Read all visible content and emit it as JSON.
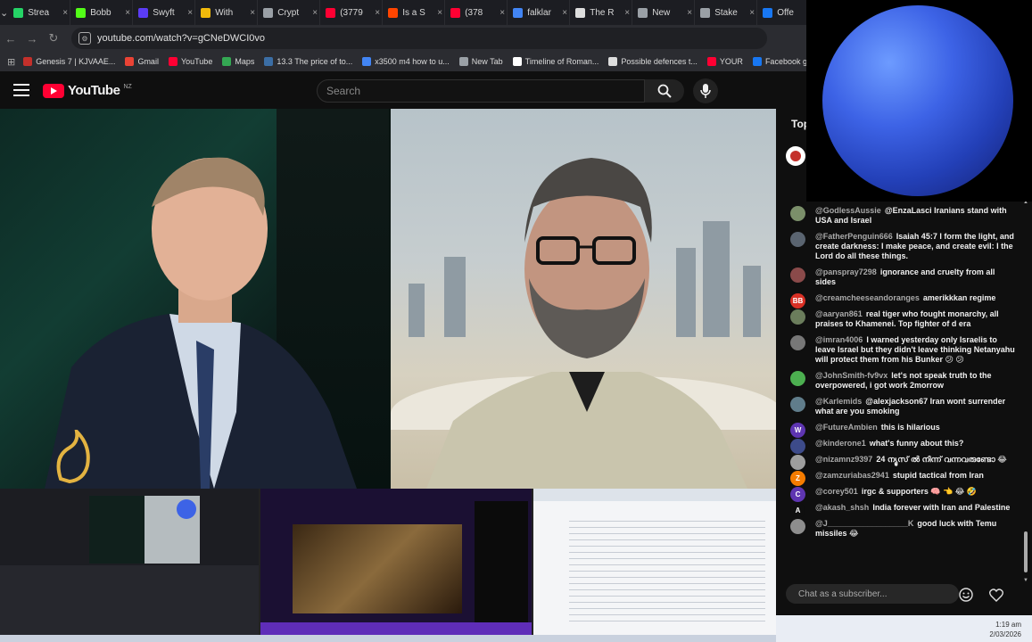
{
  "browser": {
    "tabs": [
      {
        "label": "Strea",
        "color": "#25d366"
      },
      {
        "label": "Bobb",
        "color": "#53fc18"
      },
      {
        "label": "Swyft",
        "color": "#5b3cf5"
      },
      {
        "label": "With",
        "color": "#f0b90b"
      },
      {
        "label": "Crypt",
        "color": "#9aa0a6"
      },
      {
        "label": "(3779",
        "color": "#ff0033"
      },
      {
        "label": "Is a S",
        "color": "#ff4500"
      },
      {
        "label": "(378",
        "color": "#ff0033"
      },
      {
        "label": "falklar",
        "color": "#4285f4"
      },
      {
        "label": "The R",
        "color": "#dddddd"
      },
      {
        "label": "New",
        "color": "#9aa0a6"
      },
      {
        "label": "Stake",
        "color": "#9aa0a6"
      },
      {
        "label": "Offe",
        "color": "#1877f2"
      }
    ],
    "close_glyph": "×",
    "url": "youtube.com/watch?v=gCNeDWCI0vo",
    "bookmarks": [
      {
        "label": "Genesis 7 | KJVAAE...",
        "color": "#c4302b"
      },
      {
        "label": "Gmail",
        "color": "#ea4335"
      },
      {
        "label": "YouTube",
        "color": "#ff0033"
      },
      {
        "label": "Maps",
        "color": "#34a853"
      },
      {
        "label": "13.3 The price of to...",
        "color": "#3b6ea5"
      },
      {
        "label": "x3500 m4 how to u...",
        "color": "#4285f4"
      },
      {
        "label": "New Tab",
        "color": "#9aa0a6"
      },
      {
        "label": "Timeline of Roman...",
        "color": "#ffffff"
      },
      {
        "label": "Possible defences t...",
        "color": "#dddddd"
      },
      {
        "label": "YOUR",
        "color": "#ff0033"
      },
      {
        "label": "Facebook green",
        "color": "#1877f2"
      }
    ]
  },
  "youtube": {
    "wordmark": "YouTube",
    "region": "NZ",
    "search_placeholder": "Search"
  },
  "chat": {
    "top_label": "Top",
    "input_placeholder": "Chat as a subscriber...",
    "messages": [
      {
        "author": "@GodlessAussie",
        "text": "@EnzaLasci Iranians stand with USA and Israel",
        "avatar": "",
        "avatar_color": "#7b8f6a"
      },
      {
        "author": "@FatherPenguin666",
        "text": "Isaiah 45:7 I form the light, and create darkness: I make peace, and create evil: I the Lord do all these things.",
        "avatar": "",
        "avatar_color": "#5a6470"
      },
      {
        "author": "@panspray7298",
        "text": "ignorance and cruelty from all sides",
        "avatar": "",
        "avatar_color": "#8a4a4a"
      },
      {
        "author": "@creamcheeseandoranges",
        "text": "amerikkkan regime",
        "avatar": "BB",
        "avatar_color": "#d93025"
      },
      {
        "author": "@aaryan861",
        "text": "real tiger who fought monarchy, all praises to Khamenei. Top fighter of d era",
        "avatar": "",
        "avatar_color": "#6b7d5c"
      },
      {
        "author": "@imran4006",
        "text": "I warned yesterday only Israelis to leave Israel but they didn't leave thinking Netanyahu will protect them from his Bunker 😕 😕",
        "avatar": "",
        "avatar_color": "#777777"
      },
      {
        "author": "@JohnSmith-fv9vx",
        "text": "let's not speak truth to the overpowered, i got work 2morrow",
        "avatar": "",
        "avatar_color": "#4caf50"
      },
      {
        "author": "@Karlemids",
        "text": "@alexjackson67 Iran wont surrender what are you smoking",
        "avatar": "",
        "avatar_color": "#607d8b"
      },
      {
        "author": "@FutureAmbien",
        "text": "this is hilarious",
        "avatar": "W",
        "avatar_color": "#5e35b1"
      },
      {
        "author": "@kinderone1",
        "text": "what's funny about this?",
        "avatar": "",
        "avatar_color": "#3d4b8a"
      },
      {
        "author": "@nizamnz9397",
        "text": "24 ന്യൂസ് ൽ നിന്ന് വന്നവരുണ്ടോ 😂",
        "avatar": "",
        "avatar_color": "#9e9e9e"
      },
      {
        "author": "@zamzuriabas2941",
        "text": "stupid tactical from Iran",
        "avatar": "Z",
        "avatar_color": "#f57c00"
      },
      {
        "author": "@corey501",
        "text": "irgc & supporters 🧠 👈 😂 🤣",
        "avatar": "C",
        "avatar_color": "#5e35b1"
      },
      {
        "author": "@akash_shsh",
        "text": "India forever with Iran and Palestine",
        "avatar": "A",
        "avatar_color": "#0f0f0f"
      },
      {
        "author": "@J__________________K",
        "text": "good luck with Temu missiles 😂",
        "avatar": "",
        "avatar_color": "#8d8d8d"
      }
    ]
  },
  "system": {
    "time": "1:19 am",
    "date": "2/03/2026"
  },
  "colors": {
    "yt_red": "#ff0033",
    "bg": "#0f0f0f"
  }
}
